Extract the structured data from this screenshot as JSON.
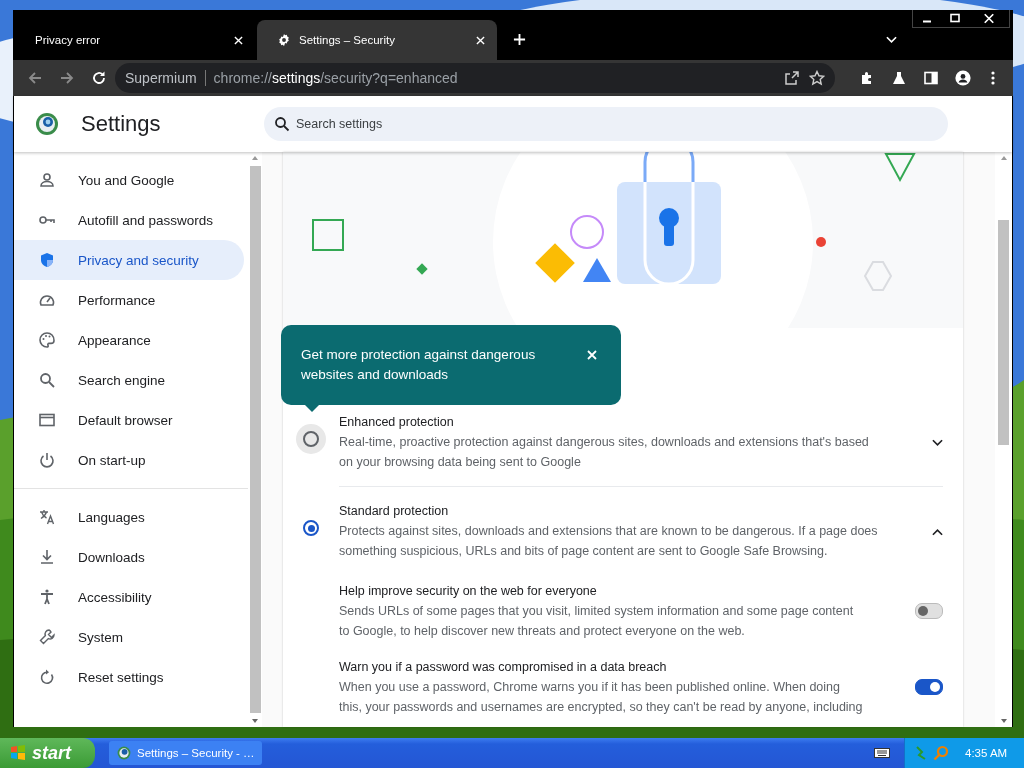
{
  "browser": {
    "tabs": [
      {
        "title": "Privacy error",
        "selected": false
      },
      {
        "title": "Settings – Security",
        "selected": true
      }
    ],
    "omnibox": {
      "site": "Supermium",
      "url": "chrome://**settings**/security?q=enhanced"
    }
  },
  "settings": {
    "title": "Settings",
    "search": {
      "placeholder": "Search settings"
    },
    "sidebar": {
      "groups": [
        [
          {
            "label": "You and Google",
            "selected": false
          },
          {
            "label": "Autofill and passwords",
            "selected": false
          },
          {
            "label": "Privacy and security",
            "selected": true
          },
          {
            "label": "Performance",
            "selected": false
          },
          {
            "label": "Appearance",
            "selected": false
          },
          {
            "label": "Search engine",
            "selected": false
          },
          {
            "label": "Default browser",
            "selected": false
          },
          {
            "label": "On start-up",
            "selected": false
          }
        ],
        [
          {
            "label": "Languages",
            "selected": false
          },
          {
            "label": "Downloads",
            "selected": false
          },
          {
            "label": "Accessibility",
            "selected": false
          },
          {
            "label": "System",
            "selected": false
          },
          {
            "label": "Reset settings",
            "selected": false
          }
        ]
      ]
    },
    "tooltip": {
      "text": "Get more protection against dangerous websites and downloads"
    },
    "options": [
      {
        "title": "Enhanced protection",
        "description": "Real-time, proactive protection against dangerous sites, downloads and extensions that's based on your browsing data being sent to Google",
        "selected": false,
        "expanded": false
      },
      {
        "title": "Standard protection",
        "description": "Protects against sites, downloads and extensions that are known to be dangerous. If a page does something suspicious, URLs and bits of page content are sent to Google Safe Browsing.",
        "selected": true,
        "expanded": true
      }
    ],
    "sub_settings": [
      {
        "title": "Help improve security on the web for everyone",
        "description": "Sends URLs of some pages that you visit, limited system information and some page content to Google, to help discover new threats and protect everyone on the web.",
        "on": false
      },
      {
        "title": "Warn you if a password was compromised in a data breach",
        "description": "When you use a password, Chrome warns you if it has been published online. When doing this, your passwords and usernames are encrypted, so they can't be read by anyone, including",
        "on": true
      }
    ]
  },
  "taskbar": {
    "start": "start",
    "task": "Settings – Security - …",
    "clock": "4:35 AM"
  }
}
